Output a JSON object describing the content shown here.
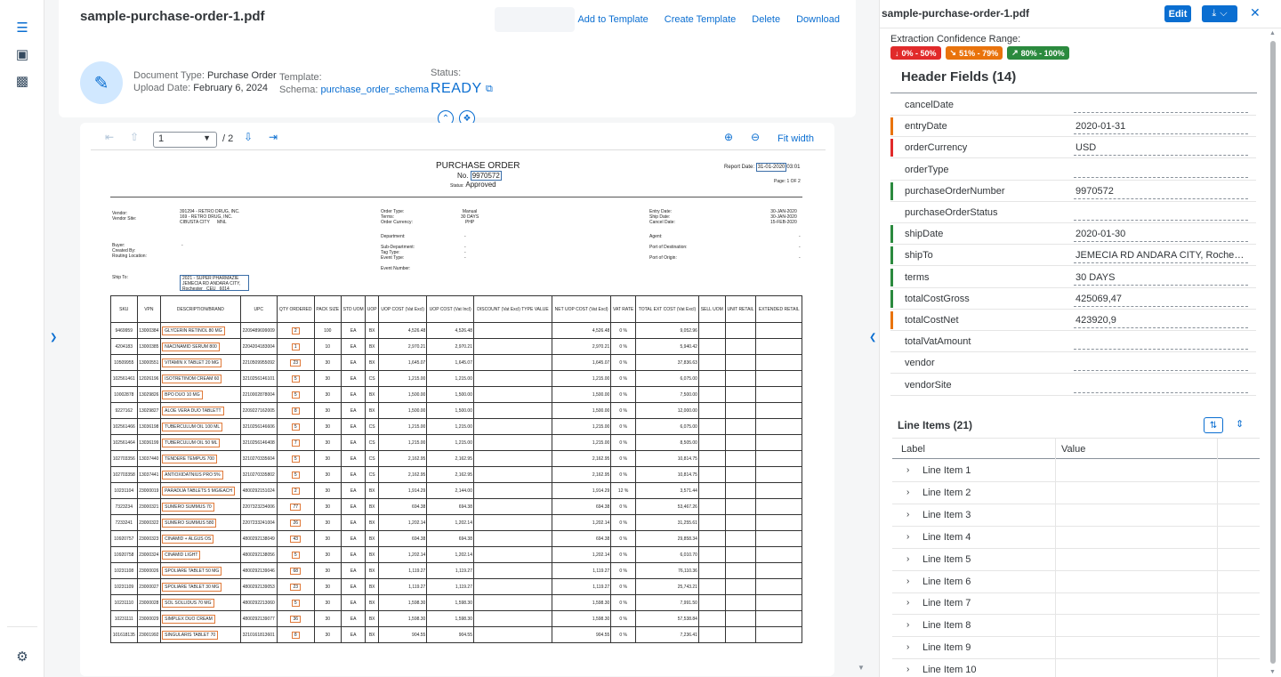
{
  "document": {
    "title": "sample-purchase-order-1.pdf",
    "actions": [
      "Add to Template",
      "Create Template",
      "Delete",
      "Download"
    ],
    "doc_type_label": "Document Type:",
    "doc_type_value": "Purchase Order",
    "upload_label": "Upload Date:",
    "upload_value": "February 6, 2024",
    "template_label": "Template:",
    "schema_label": "Schema:",
    "schema_value": "purchase_order_schema",
    "status_label": "Status:",
    "status_value": "READY"
  },
  "viewer": {
    "page_current": "1",
    "page_total": "/ 2",
    "fit_width": "Fit width"
  },
  "po": {
    "title": "PURCHASE ORDER",
    "no_label": "No.",
    "no_value": "9970572",
    "status_label": "Status:",
    "status_value": "Approved",
    "report_label": "Report Date:",
    "report_value": "31-01-2020",
    "report_time": "03:01",
    "page_of": "Page: 1 OF 2",
    "vendor_block": "Vendor:\nVendor Site:",
    "vendor_values": "391294 - RETRO DRUG, INC.\n169 - RETRO DRUG, INC.\nCIBUSTA CITY      MNL",
    "order_block": "Order Type:\nTerms:\nOrder Currency:",
    "order_values": "Manual\n30 DAYS\nPHP",
    "entry_block": "Entry Date:\nShip Date:\nCancel Date:",
    "entry_values": "30-JAN-2020\n30-JAN-2020\n15-FEB-2020",
    "buyer_block": "Buyer:\nCreated By:\nRouting Location:",
    "buyer_values": "-",
    "dept_block": "Department:\n\nSub-Department:\nTag Type:\nEvent Type:\n\nEvent Number:",
    "dept_values": "-\n\n-\n-\n-",
    "agent_block": "Agent:\n\nPort of Destination:\n\nPort of Origin:",
    "agent_values": "-\n\n-\n\n-",
    "ship_label": "Ship To:",
    "ship_value": "2021 - SUPER PHARMAZIE\nJEMECIA RD ANDARA CITY,\nRochester   CEU   6014",
    "headers": [
      "SKU",
      "VPN",
      "DESCRIPTION/BRAND",
      "UPC",
      "QTY ORDERED",
      "PACK SIZE",
      "STD UOM",
      "UOP",
      "UOP COST (Vat Excl)",
      "UOP COST (Vat Incl)",
      "DISCOUNT (Vat Excl) TYPE  VALUE",
      "NET UOP COST (Vat Excl)",
      "VAT RATE",
      "TOTAL EXT COST (Vat Excl)",
      "SELL UOM",
      "UNIT RETAIL",
      "EXTENDED RETAIL"
    ],
    "rows": [
      [
        "9469959",
        "13000384",
        "GLYCERIN RETINOL 80 MG",
        "2209489699009",
        "2",
        "100",
        "EA",
        "BX",
        "4,526.48",
        "4,526.48",
        "",
        "4,526.48",
        "0 %",
        "9,052.96"
      ],
      [
        "4204183",
        "13000385",
        "NIACINAMID SERUM 800",
        "2204204183004",
        "1",
        "10",
        "EA",
        "BX",
        "2,970.21",
        "2,970.21",
        "",
        "2,970.21",
        "0 %",
        "5,940.42"
      ],
      [
        "10509955",
        "13000551",
        "VITAMIN X TABLET 20 MG",
        "2210509955092",
        "23",
        "30",
        "EA",
        "BX",
        "1,645.07",
        "1,645.07",
        "",
        "1,645.07",
        "0 %",
        "37,836.63"
      ],
      [
        "102561461",
        "12026196",
        "ISOTRETINOM CREAM 60",
        "3210256146101",
        "5",
        "30",
        "EA",
        "CS",
        "1,215.00",
        "1,215.00",
        "",
        "1,215.00",
        "0 %",
        "6,075.00"
      ],
      [
        "10002878",
        "13029826",
        "BPO DUO 10 MG",
        "2210002878004",
        "5",
        "30",
        "EA",
        "BX",
        "1,500.00",
        "1,500.00",
        "",
        "1,500.00",
        "0 %",
        "7,500.00"
      ],
      [
        "9227162",
        "13029827",
        "ALOE VERA DUO TABLETT",
        "2209227162005",
        "8",
        "30",
        "EA",
        "BX",
        "1,500.00",
        "1,500.00",
        "",
        "1,500.00",
        "0 %",
        "12,000.00"
      ],
      [
        "102561466",
        "13036198",
        "TUBERCULUM OIL 100 ML",
        "3210256146606",
        "5",
        "30",
        "EA",
        "CS",
        "1,215.00",
        "1,215.00",
        "",
        "1,215.00",
        "0 %",
        "6,075.00"
      ],
      [
        "102561464",
        "13036199",
        "TUBERCULUM OIL 50 ML",
        "3210256146408",
        "7",
        "30",
        "EA",
        "CS",
        "1,215.00",
        "1,215.00",
        "",
        "1,215.00",
        "0 %",
        "8,505.00"
      ],
      [
        "102703356",
        "13037440",
        "TENDERE TEMPUS 700",
        "3210270335604",
        "5",
        "30",
        "EA",
        "CS",
        "2,162.95",
        "2,162.95",
        "",
        "2,162.95",
        "0 %",
        "10,814.75"
      ],
      [
        "102703358",
        "13037441",
        "ANTIOXIDATNIUS PRO 5%",
        "3210270335802",
        "5",
        "30",
        "EA",
        "CS",
        "2,162.95",
        "2,162.95",
        "",
        "2,162.95",
        "0 %",
        "10,814.75"
      ],
      [
        "10231104",
        "23000019",
        "PARADIJA TABLETS 5 MG/EACH",
        "4800292151024",
        "2",
        "30",
        "EA",
        "BX",
        "1,914.29",
        "2,144.00",
        "",
        "1,914.29",
        "12 %",
        "3,571.44"
      ],
      [
        "7323234",
        "23000321",
        "SUMERO SUMMUS 70",
        "2207323234006",
        "77",
        "30",
        "EA",
        "BX",
        "694.38",
        "694.38",
        "",
        "694.38",
        "0 %",
        "53,467.26"
      ],
      [
        "7233241",
        "23000322",
        "SUMERO SUMMUS 580",
        "2207233241004",
        "26",
        "30",
        "EA",
        "BX",
        "1,202.14",
        "1,202.14",
        "",
        "1,202.14",
        "0 %",
        "31,255.61"
      ],
      [
        "10920757",
        "23000323",
        "CINAMID + ALGUS OS",
        "4800292138049",
        "43",
        "30",
        "EA",
        "BX",
        "694.38",
        "694.38",
        "",
        "694.38",
        "0 %",
        "29,858.34"
      ],
      [
        "10920758",
        "23000324",
        "CINAMID LIGHT",
        "4800292138056",
        "5",
        "30",
        "EA",
        "BX",
        "1,202.14",
        "1,202.14",
        "",
        "1,202.14",
        "0 %",
        "6,010.70"
      ],
      [
        "10231108",
        "23000026",
        "SPOLIARE TABLET 50 MG",
        "4800292139046",
        "68",
        "30",
        "EA",
        "BX",
        "1,119.27",
        "1,119.27",
        "",
        "1,119.27",
        "0 %",
        "76,110.36"
      ],
      [
        "10231109",
        "23000027",
        "SPOLIARE TABLET 30 MG",
        "4800292139053",
        "23",
        "30",
        "EA",
        "BX",
        "1,119.27",
        "1,119.27",
        "",
        "1,119.27",
        "0 %",
        "25,743.21"
      ],
      [
        "10231110",
        "23000028",
        "SOL SOLLIDUS 70 MG",
        "4800292213060",
        "5",
        "30",
        "EA",
        "BX",
        "1,598.30",
        "1,598.30",
        "",
        "1,598.30",
        "0 %",
        "7,991.50"
      ],
      [
        "10231111",
        "23000029",
        "SIMPLEX DUO CREAM",
        "4800292139077",
        "36",
        "30",
        "EA",
        "BX",
        "1,598.30",
        "1,598.30",
        "",
        "1,598.30",
        "0 %",
        "57,538.84"
      ],
      [
        "101618135",
        "23001992",
        "SINGULARIS TABLET 70",
        "3210161813601",
        "8",
        "30",
        "EA",
        "BX",
        "904.55",
        "904.55",
        "",
        "904.55",
        "0 %",
        "7,236.41"
      ]
    ]
  },
  "panel": {
    "title": "sample-purchase-order-1.pdf",
    "edit_label": "Edit",
    "confidence_label": "Extraction Confidence Range:",
    "chips": [
      {
        "label": "0% - 50%",
        "color": "#e12a2a"
      },
      {
        "label": "51% - 79%",
        "color": "#e9730c"
      },
      {
        "label": "80% - 100%",
        "color": "#2b8a3e"
      }
    ],
    "header_fields_title": "Header Fields (14)",
    "fields": [
      {
        "label": "cancelDate",
        "value": "",
        "conf": ""
      },
      {
        "label": "entryDate",
        "value": "2020-01-31",
        "conf": "orange"
      },
      {
        "label": "orderCurrency",
        "value": "USD",
        "conf": "red"
      },
      {
        "label": "orderType",
        "value": "",
        "conf": ""
      },
      {
        "label": "purchaseOrderNumber",
        "value": "9970572",
        "conf": "green"
      },
      {
        "label": "purchaseOrderStatus",
        "value": "",
        "conf": ""
      },
      {
        "label": "shipDate",
        "value": "2020-01-30",
        "conf": "green"
      },
      {
        "label": "shipTo",
        "value": "JEMECIA RD ANDARA CITY, Rochester...",
        "conf": "green"
      },
      {
        "label": "terms",
        "value": "30 DAYS",
        "conf": "green"
      },
      {
        "label": "totalCostGross",
        "value": "425069,47",
        "conf": "green"
      },
      {
        "label": "totalCostNet",
        "value": "423920,9",
        "conf": "orange"
      },
      {
        "label": "totalVatAmount",
        "value": "",
        "conf": ""
      },
      {
        "label": "vendor",
        "value": "",
        "conf": ""
      },
      {
        "label": "vendorSite",
        "value": "",
        "conf": ""
      }
    ],
    "line_items_title": "Line Items (21)",
    "col_label": "Label",
    "col_value": "Value",
    "line_items": [
      "Line Item 1",
      "Line Item 2",
      "Line Item 3",
      "Line Item 4",
      "Line Item 5",
      "Line Item 6",
      "Line Item 7",
      "Line Item 8",
      "Line Item 9",
      "Line Item 10"
    ]
  }
}
